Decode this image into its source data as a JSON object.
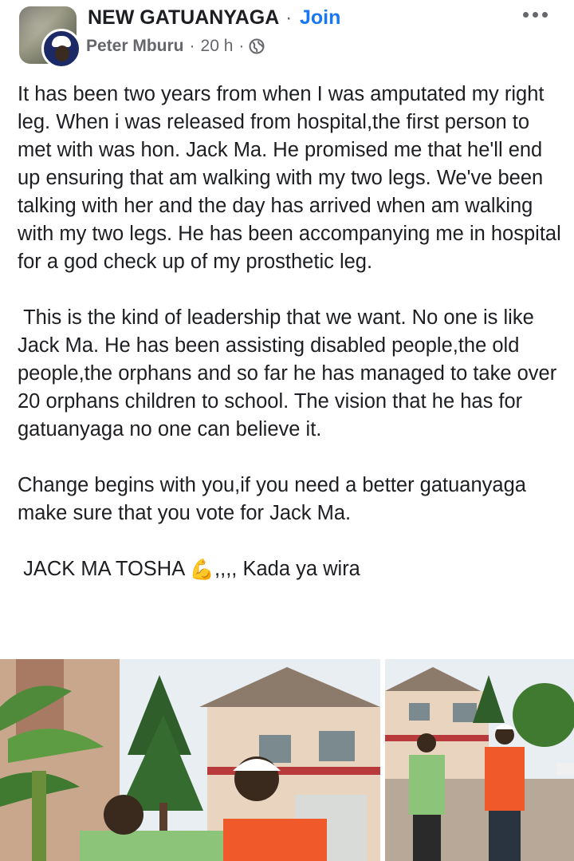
{
  "header": {
    "group_name": "NEW GATUANYAGA",
    "separator": "·",
    "join_label": "Join",
    "author": "Peter Mburu",
    "time": "20 h",
    "visibility_icon": "globe-icon",
    "more_icon": "more-options-icon"
  },
  "post": {
    "paragraphs": [
      "It has been two years from when I was amputated my right leg. When i was released from hospital,the first person to met with was hon. Jack Ma. He promised me that he'll end up ensuring that am walking with my two legs. We've been talking with her and the day has arrived when am walking with my two legs. He has been accompanying me in hospital for a god check up of my prosthetic leg.",
      " This is the kind of leadership that we want. No one is like Jack Ma. He has been assisting disabled people,the old people,the orphans and so far he has managed to take over 20 orphans children to school. The vision that he has for gatuanyaga no one can believe it.",
      "Change begins with you,if you need a better gatuanyaga make sure that you vote for Jack Ma."
    ],
    "slogan_before": " JACK MA TOSHA ",
    "slogan_emoji": "💪",
    "slogan_after": ",,,, Kada ya wira"
  },
  "photos": [
    {
      "alt": "photo-1"
    },
    {
      "alt": "photo-2"
    }
  ]
}
